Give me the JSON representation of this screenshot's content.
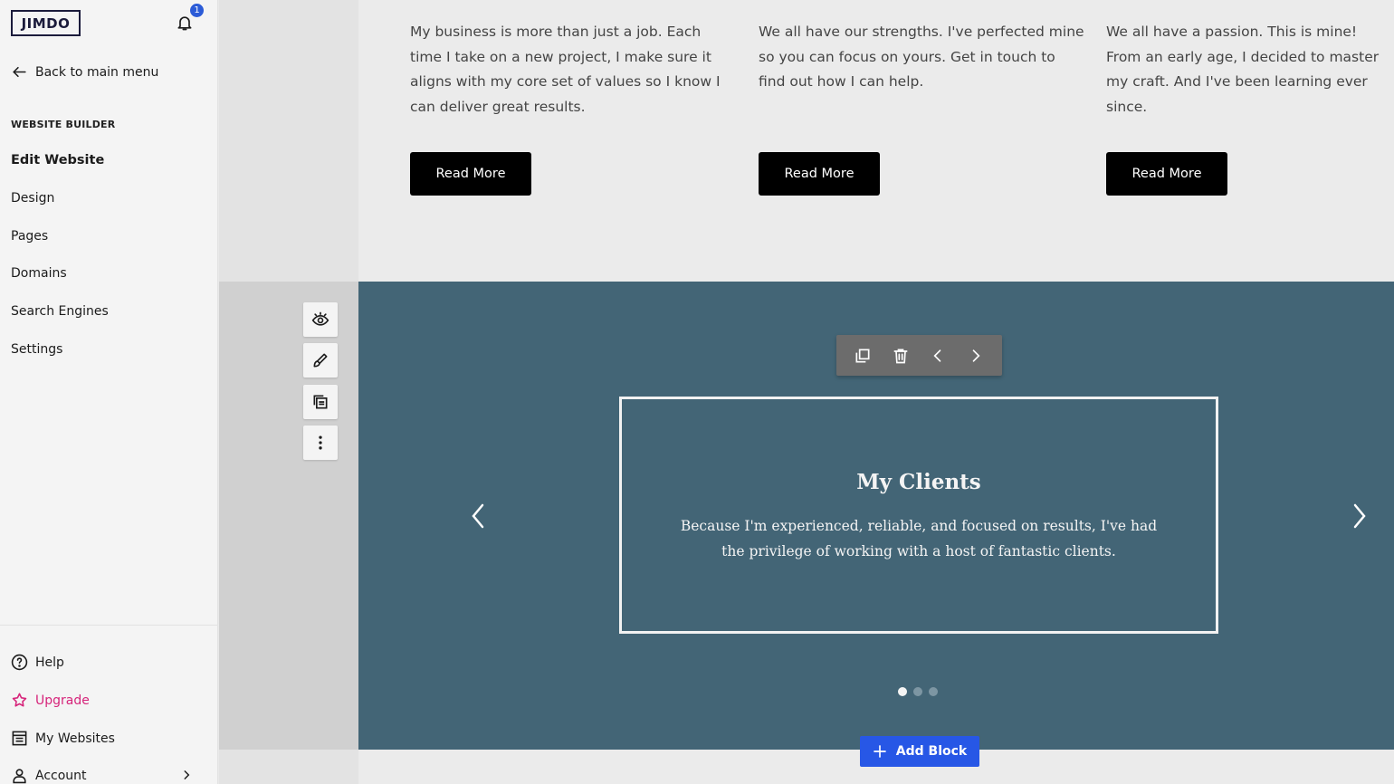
{
  "sidebar": {
    "logo": "JIMDO",
    "notification_count": "1",
    "back_label": "Back to main menu",
    "section_label": "WEBSITE BUILDER",
    "nav": [
      "Edit Website",
      "Design",
      "Pages",
      "Domains",
      "Search Engines",
      "Settings"
    ],
    "active_nav": "Edit Website",
    "bottom": {
      "help": "Help",
      "upgrade": "Upgrade",
      "my_websites": "My Websites",
      "account": "Account"
    }
  },
  "columns": [
    {
      "text": "My business is more than just a job. Each time I take on a new project, I make sure it aligns with my core set of values so I know I can deliver great results.",
      "button": "Read More"
    },
    {
      "text": "We all have our strengths. I've perfected mine so you can focus on yours. Get in touch to find out how I can help.",
      "button": "Read More"
    },
    {
      "text": "We all have a passion. This is mine! From an early age, I decided to master my craft. And I've been learning ever since.",
      "button": "Read More"
    }
  ],
  "slider": {
    "title": "My Clients",
    "text": "Because I'm experienced, reliable, and focused on results, I've had the privilege of working with a host of fantastic clients.",
    "slide_count": 3,
    "active_slide": 1
  },
  "add_block_label": "Add Block",
  "colors": {
    "sidebar_bg": "#f4f4f4",
    "slider_bg": "#436576",
    "accent_blue": "#2757e6",
    "upgrade_pink": "#d6247a",
    "button_black": "#000000"
  },
  "icons": {
    "bell": "bell-icon",
    "back": "arrow-left-icon",
    "help": "question-circle-icon",
    "upgrade": "star-icon",
    "my_websites": "list-icon",
    "account": "user-icon",
    "tools": [
      "eye-icon",
      "paint-brush-icon",
      "copy-icon",
      "more-vertical-icon"
    ],
    "toolbar": [
      "duplicate-icon",
      "trash-icon",
      "chevron-left-icon",
      "chevron-right-icon"
    ]
  }
}
